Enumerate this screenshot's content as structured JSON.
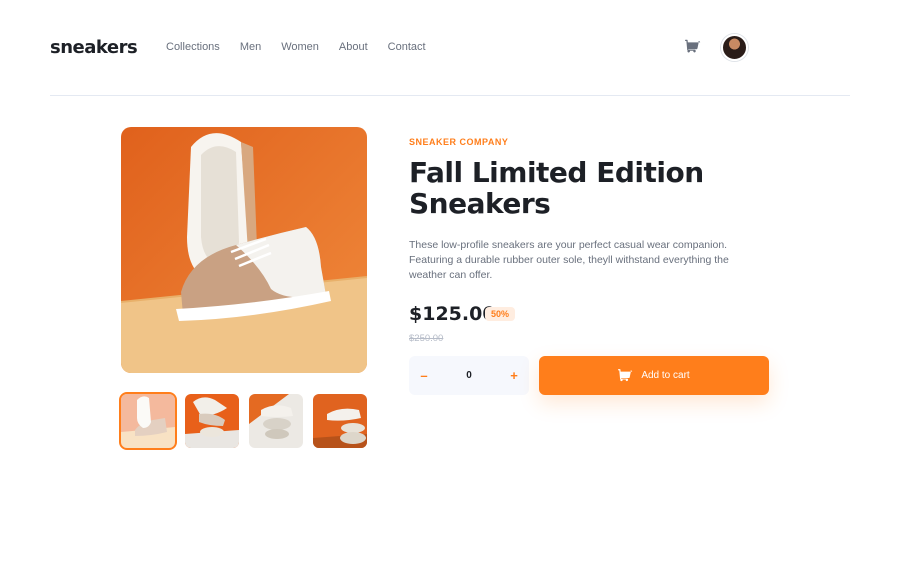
{
  "header": {
    "logo": "sneakers",
    "nav": [
      "Collections",
      "Men",
      "Women",
      "About",
      "Contact"
    ],
    "cart_icon": "cart-icon",
    "avatar_icon": "user-avatar"
  },
  "product": {
    "company": "SNEAKER COMPANY",
    "title": "Fall Limited Edition Sneakers",
    "description": "These low-profile sneakers are your perfect casual wear companion. Featuring a durable rubber outer sole, theyll withstand everything the weather can offer.",
    "price": "$125.00",
    "discount": "50%",
    "original_price": "$250.00"
  },
  "quantity": {
    "minus": "–",
    "value": "0",
    "plus": "+"
  },
  "add_to_cart": {
    "label": "Add to cart",
    "icon": "cart-icon"
  },
  "gallery": {
    "thumbnails": [
      "thumbnail-1",
      "thumbnail-2",
      "thumbnail-3",
      "thumbnail-4"
    ],
    "active_index": 0
  },
  "colors": {
    "accent": "#ff7e1b",
    "accent_pale": "#ffede0",
    "dark": "#1d2026",
    "gray": "#69707d",
    "light_bg": "#f6f8fd"
  }
}
